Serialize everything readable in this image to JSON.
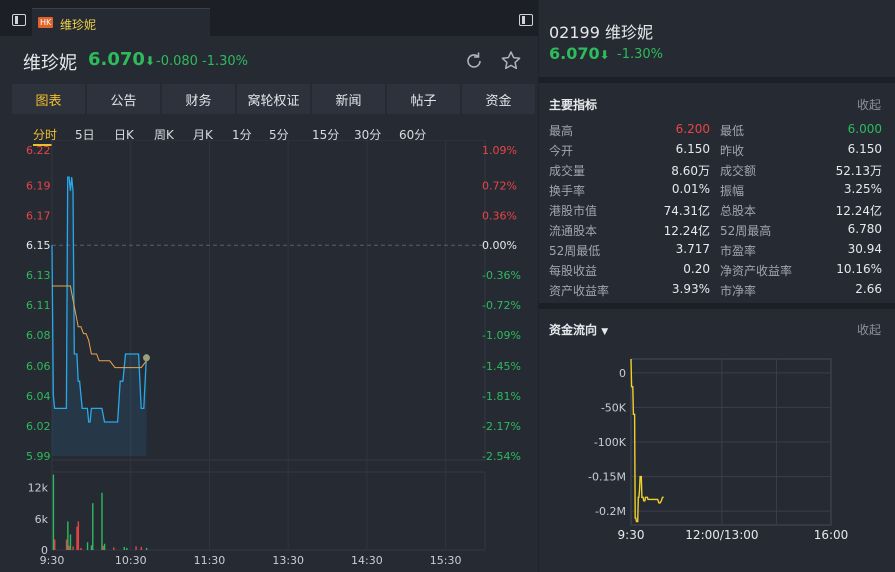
{
  "tab": {
    "market": "HK",
    "name": "维珍妮"
  },
  "stock": {
    "name": "维珍妮",
    "price": "6.070",
    "arrow": "⬇",
    "change": "-0.080",
    "pct": "-1.30%",
    "code": "02199"
  },
  "nav_tabs": [
    "图表",
    "公告",
    "财务",
    "窝轮权证",
    "新闻",
    "帖子",
    "资金"
  ],
  "periods": [
    "分时",
    "5日",
    "日K",
    "周K",
    "月K",
    "1分",
    "5分",
    "15分",
    "30分",
    "60分"
  ],
  "colors": {
    "up": "#e84545",
    "down": "#2dbb5c",
    "accent": "#f0c02c",
    "avg_line": "#e9a64a",
    "price_line": "#29a8e8",
    "flow_line": "#f0d02a"
  },
  "chart_data": [
    {
      "type": "line",
      "name_hint": "intraday",
      "y_ticks": [
        "6.22",
        "6.19",
        "6.17",
        "6.15",
        "6.13",
        "6.11",
        "6.08",
        "6.06",
        "6.04",
        "6.02",
        "5.99"
      ],
      "y_tick_values": [
        6.22,
        6.194,
        6.172,
        6.15,
        6.128,
        6.106,
        6.084,
        6.061,
        6.039,
        6.017,
        5.995
      ],
      "pct_ticks": [
        "1.09%",
        "0.72%",
        "0.36%",
        "0.00%",
        "-0.36%",
        "-0.72%",
        "-1.09%",
        "-1.45%",
        "-1.81%",
        "-2.17%",
        "-2.54%"
      ],
      "x_ticks": [
        "9:30",
        "10:30",
        "11:30",
        "13:30",
        "14:30",
        "15:30"
      ],
      "x_tick_minutes": [
        0,
        60,
        120,
        180,
        240,
        300
      ],
      "x_range": [
        0,
        330
      ],
      "ylim": [
        5.995,
        6.22
      ],
      "prev_close": 6.15,
      "series": [
        {
          "values_minutes": [
            0,
            1,
            2,
            3,
            4,
            5,
            6,
            7,
            8,
            9,
            10,
            11,
            12,
            13,
            14,
            15,
            16,
            17,
            18,
            19,
            20,
            21,
            22,
            23,
            24,
            25,
            26,
            27,
            28,
            29,
            30,
            32,
            34,
            36,
            38,
            40,
            42,
            44,
            46,
            48,
            50,
            52,
            54,
            56,
            58,
            60,
            62,
            64,
            66,
            68,
            70,
            72
          ],
          "values": [
            6.15,
            6.04,
            6.03,
            6.03,
            6.03,
            6.03,
            6.03,
            6.03,
            6.03,
            6.03,
            6.03,
            6.03,
            6.2,
            6.2,
            6.19,
            6.2,
            6.19,
            6.07,
            6.07,
            6.07,
            6.05,
            6.05,
            6.04,
            6.03,
            6.03,
            6.03,
            6.03,
            6.03,
            6.02,
            6.02,
            6.03,
            6.03,
            6.03,
            6.03,
            6.03,
            6.02,
            6.02,
            6.02,
            6.02,
            6.02,
            6.02,
            6.05,
            6.05,
            6.07,
            6.07,
            6.07,
            6.07,
            6.07,
            6.07,
            6.03,
            6.03,
            6.07
          ]
        },
        {
          "values_minutes": [
            0,
            2,
            4,
            6,
            8,
            10,
            12,
            14,
            16,
            18,
            20,
            22,
            24,
            26,
            28,
            30,
            32,
            34,
            36,
            38,
            40,
            44,
            48,
            52,
            56,
            60,
            64,
            68,
            72
          ],
          "values": [
            6.12,
            6.12,
            6.12,
            6.12,
            6.12,
            6.12,
            6.12,
            6.12,
            6.11,
            6.1,
            6.09,
            6.09,
            6.085,
            6.085,
            6.08,
            6.07,
            6.07,
            6.07,
            6.065,
            6.065,
            6.065,
            6.065,
            6.06,
            6.06,
            6.06,
            6.06,
            6.06,
            6.06,
            6.065
          ]
        }
      ],
      "volume": {
        "y_ticks": [
          "12k",
          "6k",
          "0"
        ],
        "y_tick_values": [
          12000,
          6000,
          0
        ],
        "ylim": [
          0,
          15000
        ],
        "bars": [
          {
            "minute": 1,
            "value": 14500,
            "dir": "up"
          },
          {
            "minute": 2,
            "value": 2000,
            "dir": "down"
          },
          {
            "minute": 11,
            "value": 2000,
            "dir": "down"
          },
          {
            "minute": 12,
            "value": 5500,
            "dir": "up"
          },
          {
            "minute": 13,
            "value": 800,
            "dir": "down"
          },
          {
            "minute": 14,
            "value": 3000,
            "dir": "up"
          },
          {
            "minute": 16,
            "value": 700,
            "dir": "down"
          },
          {
            "minute": 19,
            "value": 4500,
            "dir": "down"
          },
          {
            "minute": 20,
            "value": 5500,
            "dir": "down"
          },
          {
            "minute": 22,
            "value": 400,
            "dir": "down"
          },
          {
            "minute": 27,
            "value": 1500,
            "dir": "up"
          },
          {
            "minute": 30,
            "value": 900,
            "dir": "up"
          },
          {
            "minute": 31,
            "value": 9000,
            "dir": "up"
          },
          {
            "minute": 38,
            "value": 11000,
            "dir": "up"
          },
          {
            "minute": 39,
            "value": 800,
            "dir": "down"
          },
          {
            "minute": 40,
            "value": 1200,
            "dir": "up"
          },
          {
            "minute": 47,
            "value": 500,
            "dir": "down"
          },
          {
            "minute": 55,
            "value": 600,
            "dir": "up"
          },
          {
            "minute": 57,
            "value": 400,
            "dir": "up"
          },
          {
            "minute": 64,
            "value": 700,
            "dir": "down"
          },
          {
            "minute": 68,
            "value": 600,
            "dir": "down"
          },
          {
            "minute": 72,
            "value": 400,
            "dir": "up"
          }
        ]
      }
    },
    {
      "type": "line",
      "name_hint": "fund-flow",
      "y_ticks": [
        "0",
        "-50K",
        "-100K",
        "-0.15M",
        "-0.2M"
      ],
      "y_tick_values": [
        0,
        -50000,
        -100000,
        -150000,
        -200000
      ],
      "ylim": [
        -220000,
        20000
      ],
      "x_ticks": [
        "9:30",
        "12:00/13:00",
        "16:00"
      ],
      "x_tick_minutes": [
        0,
        150,
        330
      ],
      "x_range": [
        0,
        330
      ],
      "series": [
        {
          "values_minutes": [
            0,
            1,
            2,
            3,
            4,
            5,
            6,
            7,
            8,
            9,
            10,
            11,
            12,
            13,
            14,
            15,
            16,
            17,
            18,
            19,
            20,
            21,
            22,
            23,
            24,
            25,
            26,
            27,
            28,
            29,
            30,
            32,
            34,
            36,
            38,
            40,
            42,
            44,
            46,
            48,
            50,
            52,
            54
          ],
          "values": [
            20000,
            -20000,
            -20000,
            -20000,
            -60000,
            -60000,
            -60000,
            -210000,
            -210000,
            -215000,
            -215000,
            -215000,
            -180000,
            -180000,
            -170000,
            -150000,
            -150000,
            -150000,
            -180000,
            -180000,
            -180000,
            -185000,
            -185000,
            -185000,
            -180000,
            -180000,
            -180000,
            -180000,
            -183000,
            -183000,
            -183000,
            -183000,
            -183000,
            -183000,
            -183000,
            -183000,
            -183000,
            -183000,
            -188000,
            -188000,
            -185000,
            -180000,
            -180000
          ]
        }
      ]
    }
  ],
  "key_metrics": {
    "title": "主要指标",
    "collapse": "收起",
    "rows": [
      [
        {
          "k": "最高",
          "v": "6.200",
          "c": "up"
        },
        {
          "k": "最低",
          "v": "6.000",
          "c": "down"
        }
      ],
      [
        {
          "k": "今开",
          "v": "6.150",
          "c": ""
        },
        {
          "k": "昨收",
          "v": "6.150",
          "c": ""
        }
      ],
      [
        {
          "k": "成交量",
          "v": "8.60万",
          "c": ""
        },
        {
          "k": "成交额",
          "v": "52.13万",
          "c": ""
        }
      ],
      [
        {
          "k": "换手率",
          "v": "0.01%",
          "c": ""
        },
        {
          "k": "振幅",
          "v": "3.25%",
          "c": ""
        }
      ],
      [
        {
          "k": "港股市值",
          "v": "74.31亿",
          "c": ""
        },
        {
          "k": "总股本",
          "v": "12.24亿",
          "c": ""
        }
      ],
      [
        {
          "k": "流通股本",
          "v": "12.24亿",
          "c": ""
        },
        {
          "k": "52周最高",
          "v": "6.780",
          "c": ""
        }
      ],
      [
        {
          "k": "52周最低",
          "v": "3.717",
          "c": ""
        },
        {
          "k": "市盈率",
          "v": "30.94",
          "c": ""
        }
      ],
      [
        {
          "k": "每股收益",
          "v": "0.20",
          "c": ""
        },
        {
          "k": "净资产收益率",
          "v": "10.16%",
          "c": ""
        }
      ],
      [
        {
          "k": "资产收益率",
          "v": "3.93%",
          "c": ""
        },
        {
          "k": "市净率",
          "v": "2.66",
          "c": ""
        }
      ]
    ]
  },
  "fund_flow": {
    "title": "资金流向",
    "collapse": "收起"
  }
}
